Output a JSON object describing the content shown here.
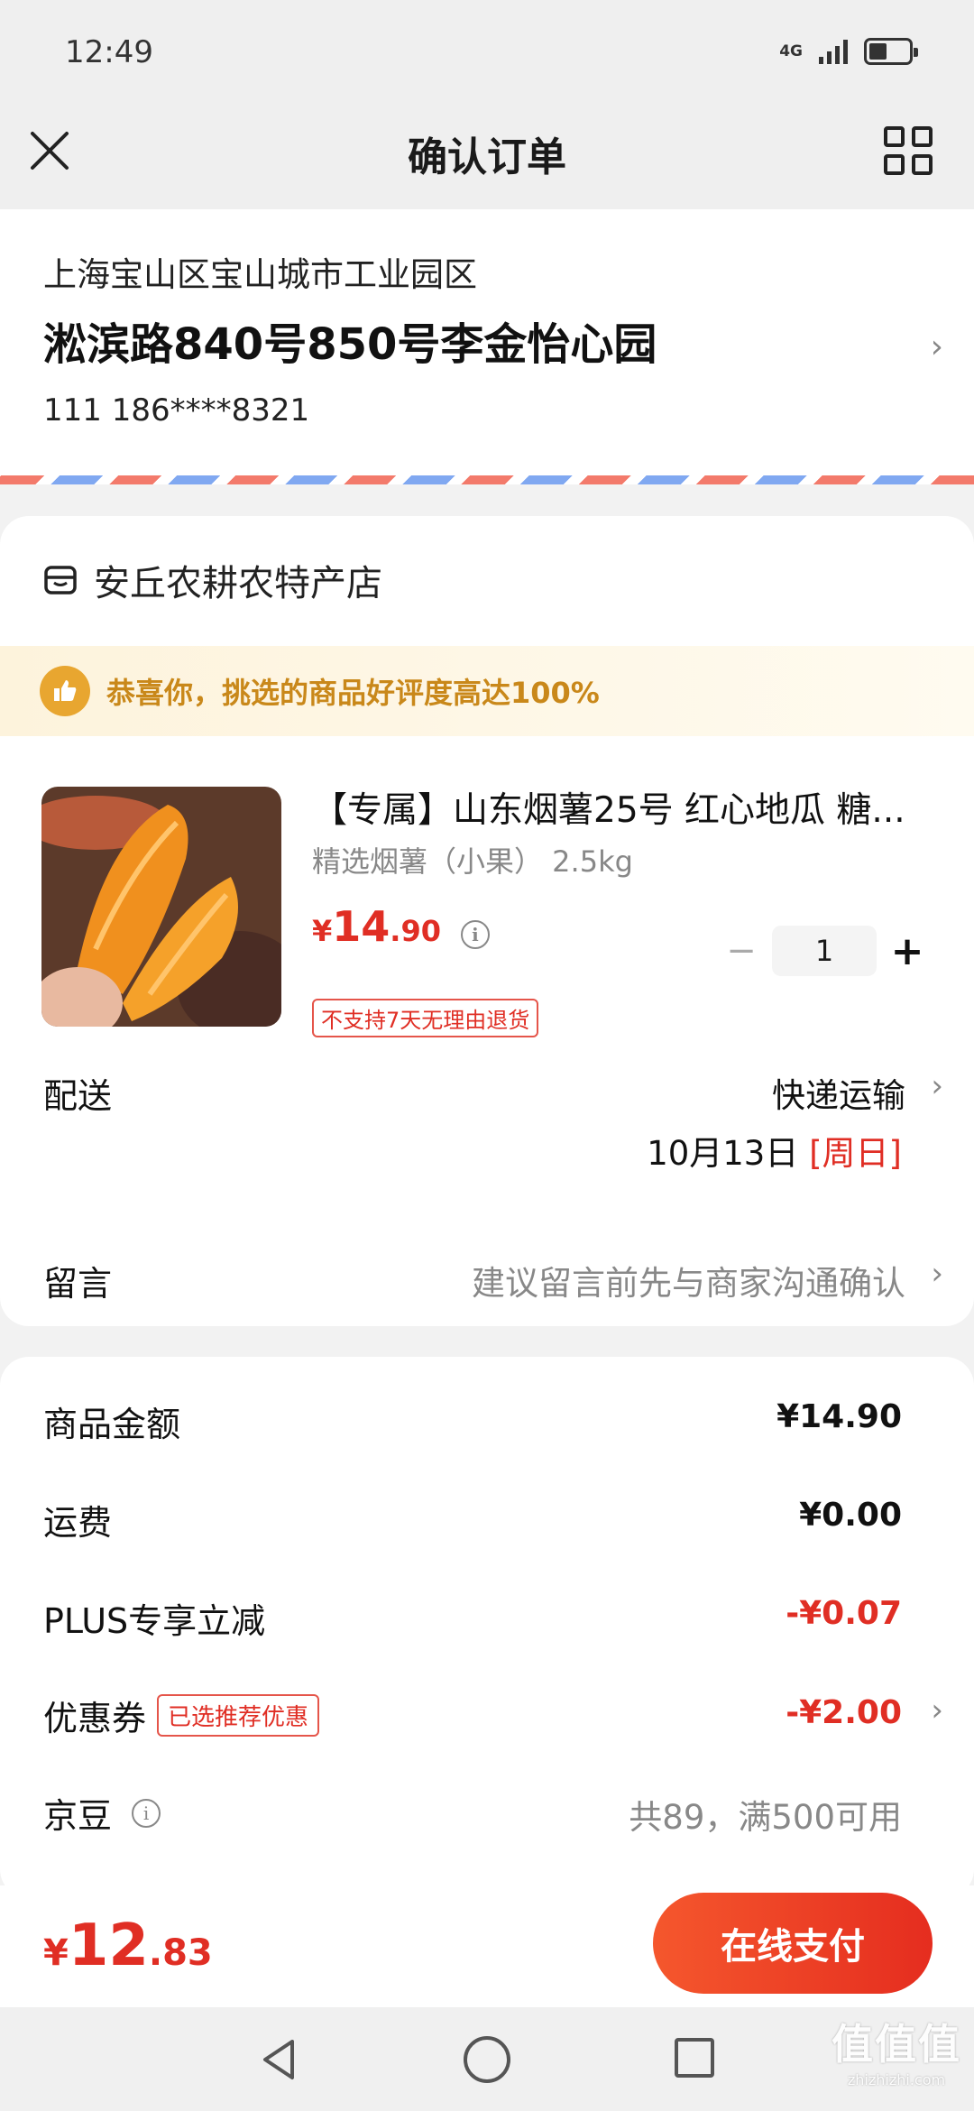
{
  "status_bar": {
    "time": "12:49",
    "network": "4G",
    "battery_level": 0.45
  },
  "nav": {
    "title": "确认订单"
  },
  "address": {
    "region": "上海宝山区宝山城市工业园区",
    "detail": "淞滨路840号850号李金怡心园",
    "contact": "111 186****8321"
  },
  "store": {
    "name": "安丘农耕农特产店",
    "promo_text": "恭喜你，挑选的商品好评度高达100%"
  },
  "product": {
    "title": "【专属】山东烟薯25号 红心地瓜 糖...",
    "spec": "精选烟薯（小果） 2.5kg",
    "price_symbol": "¥",
    "price_int": "14",
    "price_dec": ".90",
    "quantity": "1",
    "return_policy": "不支持7天无理由退货"
  },
  "delivery": {
    "label": "配送",
    "method": "快递运输",
    "date": "10月13日",
    "day_of_week": "[周日]"
  },
  "note": {
    "label": "留言",
    "placeholder": "建议留言前先与商家沟通确认"
  },
  "summary": {
    "goods_label": "商品金额",
    "goods_value": "¥14.90",
    "shipping_label": "运费",
    "shipping_value": "¥0.00",
    "plus_label": "PLUS专享立减",
    "plus_value": "-¥0.07",
    "coupon_label": "优惠券",
    "coupon_tag": "已选推荐优惠",
    "coupon_value": "-¥2.00",
    "beans_label": "京豆",
    "beans_value": "共89，满500可用"
  },
  "bottom": {
    "total_symbol": "¥",
    "total_int": "12",
    "total_dec": ".83",
    "pay_label": "在线支付"
  },
  "watermark": {
    "main": "值值值",
    "sub": "zhizhizhi.com"
  },
  "colors": {
    "accent_red": "#e02e24",
    "promo_gold": "#c9881a"
  }
}
